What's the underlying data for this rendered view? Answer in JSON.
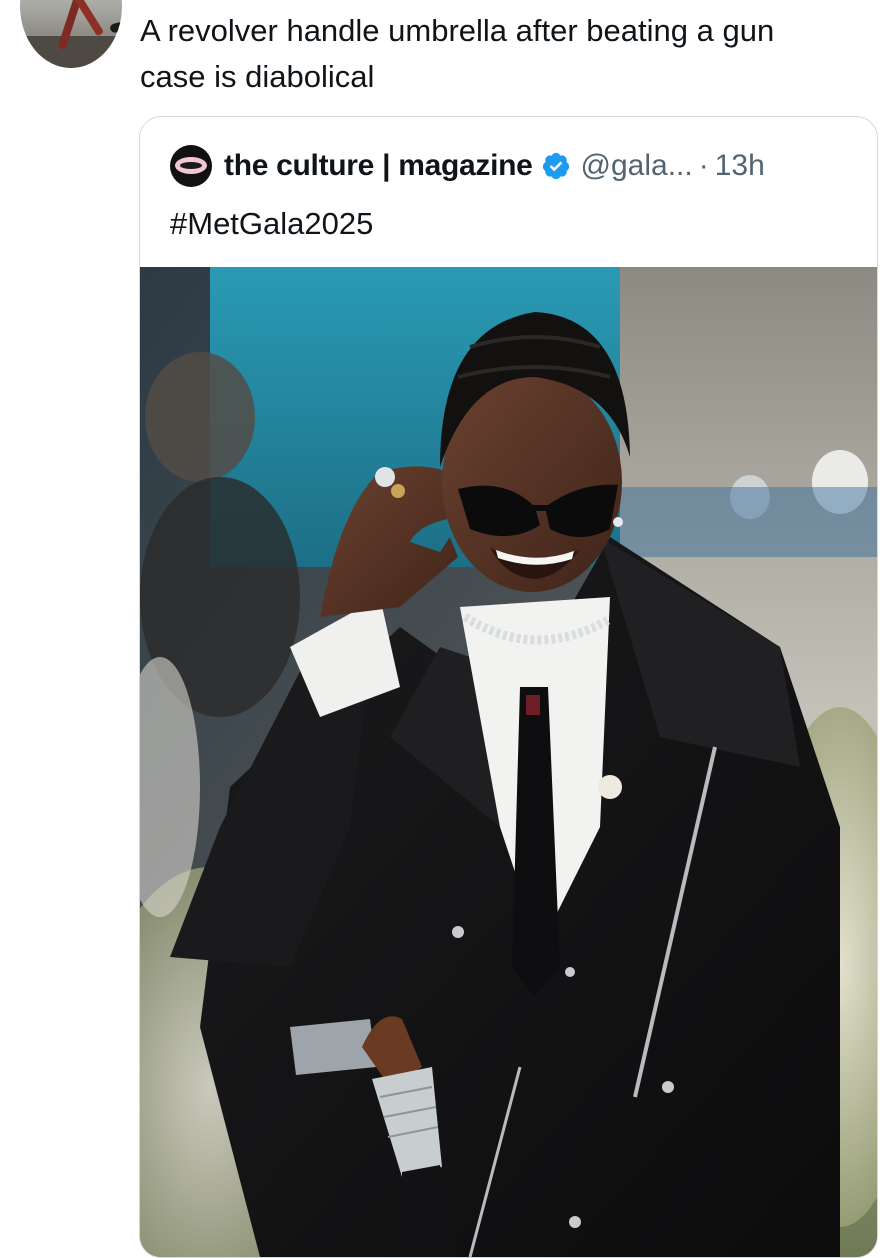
{
  "tweet": {
    "text_line1": "A revolver handle umbrella after beating a gun",
    "text_line2": "case is diabolical"
  },
  "quote": {
    "author_name": "the culture | magazine",
    "handle": "@gala...",
    "separator": "·",
    "timestamp": "13h",
    "text": "#MetGala2025",
    "verified_badge_color": "#1d9bf0"
  },
  "icons": {
    "verified": "verified-badge-icon"
  },
  "colors": {
    "text_primary": "#0f1419",
    "text_secondary": "#536471",
    "card_border": "#cfd9de",
    "accent": "#1d9bf0"
  }
}
